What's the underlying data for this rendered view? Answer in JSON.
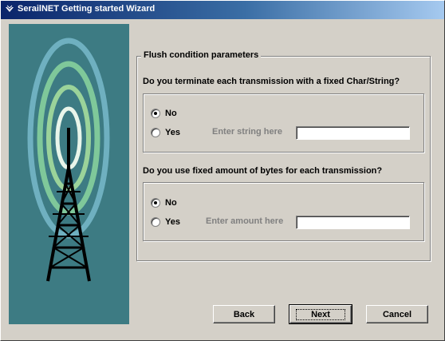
{
  "window": {
    "title": "SerailNET Getting started Wizard"
  },
  "group": {
    "legend": "Flush condition parameters"
  },
  "section1": {
    "question": "Do you terminate each transmission with a fixed Char/String?",
    "option_no": "No",
    "option_yes": "Yes",
    "selected": "No",
    "hint": "Enter string here",
    "value": ""
  },
  "section2": {
    "question": "Do you use fixed amount of bytes for each transmission?",
    "option_no": "No",
    "option_yes": "Yes",
    "selected": "No",
    "hint": "Enter amount here",
    "value": ""
  },
  "buttons": {
    "back": "Back",
    "next": "Next",
    "cancel": "Cancel"
  },
  "colors": {
    "title_bar": "#0a246a",
    "dialog": "#d4d0c8",
    "image_bg": "#3d7b83"
  }
}
